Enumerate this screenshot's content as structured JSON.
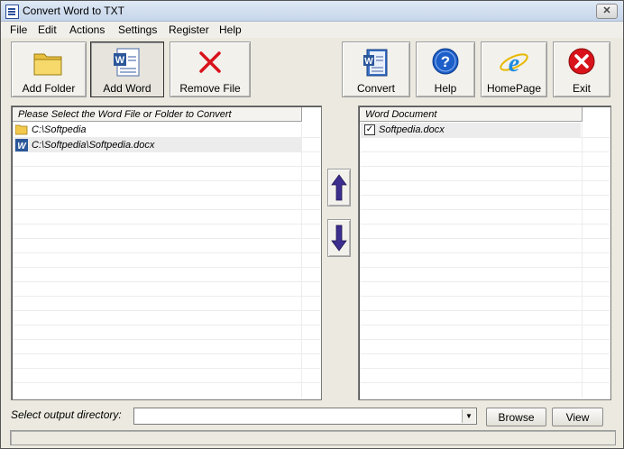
{
  "window": {
    "title": "Convert Word to TXT"
  },
  "menu": [
    "File",
    "Edit",
    "Actions",
    "Settings",
    "Register",
    "Help"
  ],
  "toolbar": {
    "add_folder": "Add Folder",
    "add_word": "Add Word",
    "remove_file": "Remove File",
    "convert": "Convert",
    "help": "Help",
    "homepage": "HomePage",
    "exit": "Exit"
  },
  "left_panel": {
    "header": "Please Select the Word File or Folder to Convert",
    "items": [
      {
        "icon": "folder-icon",
        "text": "C:\\Softpedia"
      },
      {
        "icon": "word-doc-icon",
        "text": "C:\\Softpedia\\Softpedia.docx"
      }
    ]
  },
  "right_panel": {
    "header": "Word Document",
    "items": [
      {
        "checked": true,
        "text": "Softpedia.docx"
      }
    ]
  },
  "output": {
    "label": "Select  output directory:",
    "value": "",
    "browse": "Browse",
    "view": "View"
  },
  "colors": {
    "exit_red": "#d8131b",
    "remove_red": "#d8131b",
    "arrow_purple": "#3b2e8f",
    "help_blue": "#1d5fc9"
  }
}
